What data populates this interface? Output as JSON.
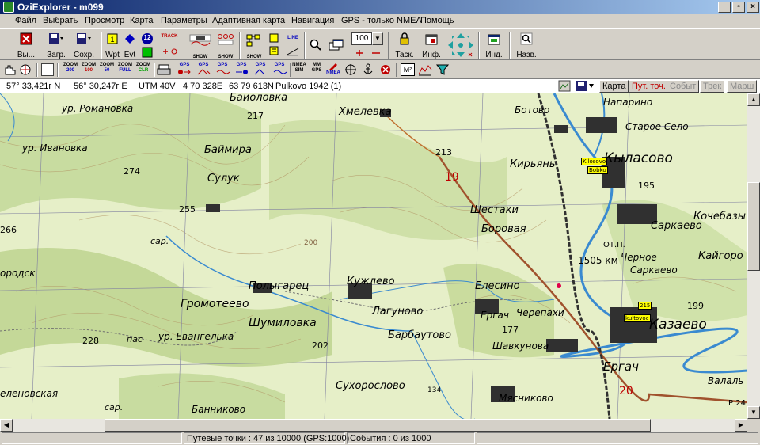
{
  "window": {
    "title": "OziExplorer - m099",
    "min": "_",
    "max": "▫",
    "close": "×"
  },
  "menu": [
    "Файл",
    "Выбрать",
    "Просмотр",
    "Карта",
    "Параметры",
    "Адаптивная карта",
    "Навигация",
    "GPS - только NMEA",
    "Помощь"
  ],
  "toolbar": {
    "exit": "Вы...",
    "load": "Загр.",
    "save": "Сохр.",
    "wpt": "Wpt",
    "evt": "Evt",
    "badge12": "12",
    "track": "TRACK",
    "show1": "SHOW",
    "show2": "SHOW",
    "show3": "SHOW",
    "line": "LINE",
    "zoom_value": "100",
    "task": "Таск.",
    "info": "Инф.",
    "ind": "Инд.",
    "names": "Назв."
  },
  "toolbar2": {
    "zoom": [
      [
        "ZOOM",
        "200"
      ],
      [
        "ZOOM",
        "100"
      ],
      [
        "ZOOM",
        "50"
      ],
      [
        "ZOOM",
        "FULL"
      ],
      [
        "ZOOM",
        "CLR"
      ]
    ],
    "gps": [
      "GPS",
      "GPS",
      "GPS",
      "GPS",
      "GPS",
      "GPS"
    ],
    "nmea_sim": [
      "NMEA",
      "SIM"
    ],
    "mm_gps": [
      "MM",
      "GPS"
    ],
    "nmea": "NMEA",
    "m2": "M²"
  },
  "coords": {
    "lat": "57° 33,421г N",
    "lon": "56° 30,247г E",
    "utm": "UTM  40V",
    "east": "4 70 328E",
    "north": "63 79 613N",
    "datum": "Pulkovo 1942 (1)"
  },
  "modes": {
    "map": "Карта",
    "wpt": "Пут. точ.",
    "evt": "Событ",
    "trk": "Трек",
    "rte": "Марш"
  },
  "map_labels": [
    "Баиоловка",
    "ур. Романовка",
    "Хмелевка",
    "Ботово",
    "Напарино",
    "Старое Село",
    "Кыласово",
    "ур. Ивановка",
    "Баймира",
    "Сулук",
    "Кирьянь",
    "Шестаки",
    "Боровая",
    "Кочебазы",
    "Саркаево",
    "Кайгоро",
    "Черное",
    "Саркаево",
    "Полыгарец",
    "Кужлево",
    "Лагуново",
    "Елесино",
    "Ергач",
    "Черепахи",
    "Громотеево",
    "Шумиловка",
    "ур. Евангелька",
    "Барбаутово",
    "Шавкунова",
    "Казаево",
    "Ергач",
    "Сухорослово",
    "Мясниково",
    "Банниково",
    "Валаль",
    "еленовская",
    "пас",
    "сар.",
    "сар.",
    "ородск",
    "ОТ.П.",
    "1505 км"
  ],
  "map_numbers": [
    "217",
    "213",
    "274",
    "255",
    "195",
    "266",
    "200",
    "202",
    "228",
    "177",
    "199",
    "134",
    "20",
    "19",
    "Р 24"
  ],
  "waypoints": {
    "w1": "Kilosovo",
    "w2": "Bobko",
    "w3": "215",
    "w4": "kultovoc"
  },
  "status": {
    "left": "",
    "wpts": "Путевые точки : 47 из 10000  (GPS:1000)",
    "events": "События : 0 из 1000",
    "right": ""
  },
  "colors": {
    "title_from": "#0a246a",
    "title_to": "#a6caf0",
    "active_mode": "#c00000",
    "map_forest": "#c8dca0",
    "map_water": "#3a8ad0",
    "map_road": "#a0522d",
    "waypoint": "#ffff00"
  }
}
